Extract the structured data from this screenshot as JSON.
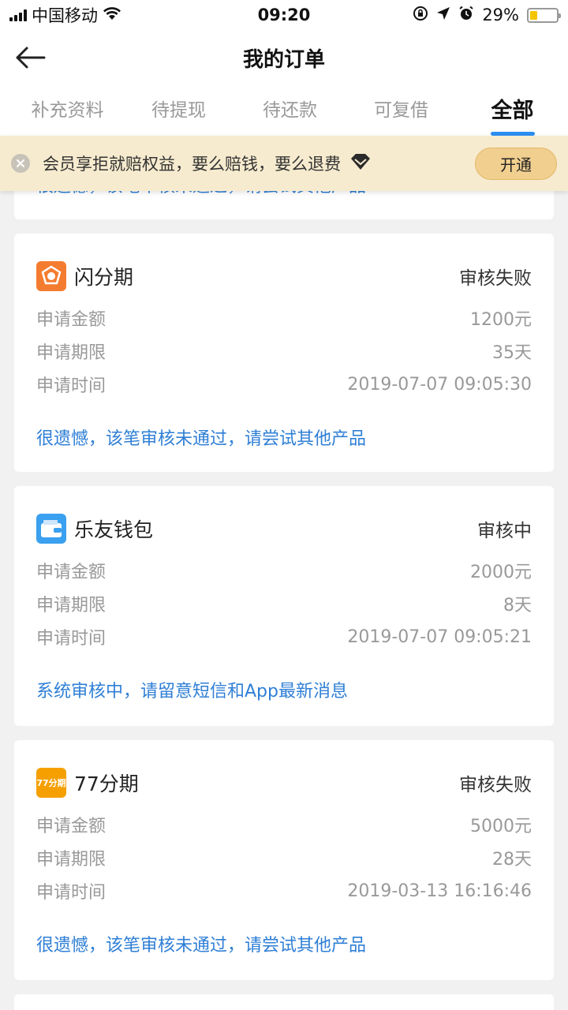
{
  "status_bar": {
    "carrier": "中国移动",
    "time": "09:20",
    "battery": "29%",
    "battery_level": 0.29,
    "icons": [
      "signal-icon",
      "wifi-icon",
      "lock-rotation-icon",
      "location-icon",
      "alarm-icon",
      "battery-icon"
    ]
  },
  "header": {
    "title": "我的订单",
    "back_icon": "arrow-left-icon"
  },
  "tabs": [
    {
      "label": "补充资料",
      "active": false
    },
    {
      "label": "待提现",
      "active": false
    },
    {
      "label": "待还款",
      "active": false
    },
    {
      "label": "可复借",
      "active": false
    },
    {
      "label": "全部",
      "active": true
    }
  ],
  "banner": {
    "text": "会员享拒就赔权益，要么赔钱，要么退费",
    "button": "开通",
    "close_icon": "close-icon",
    "badge_icon": "diamond-icon"
  },
  "partial_card": {
    "message": "很遗憾，该笔审核未通过，请尝试其他产品"
  },
  "orders": [
    {
      "name": "闪分期",
      "status": "审核失败",
      "amount_label": "申请金额",
      "amount": "1200元",
      "term_label": "申请期限",
      "term": "35天",
      "time_label": "申请时间",
      "time": "2019-07-07 09:05:30",
      "message": "很遗憾，该笔审核未通过，请尝试其他产品",
      "logo_color": "#f47c30"
    },
    {
      "name": "乐友钱包",
      "status": "审核中",
      "amount_label": "申请金额",
      "amount": "2000元",
      "term_label": "申请期限",
      "term": "8天",
      "time_label": "申请时间",
      "time": "2019-07-07 09:05:21",
      "message": "系统审核中，请留意短信和App最新消息",
      "logo_color": "#3aa0f0"
    },
    {
      "name": "77分期",
      "status": "审核失败",
      "amount_label": "申请金额",
      "amount": "5000元",
      "term_label": "申请期限",
      "term": "28天",
      "time_label": "申请时间",
      "time": "2019-03-13 16:16:46",
      "message": "很遗憾，该笔审核未通过，请尝试其他产品",
      "logo_color": "#f5a000",
      "logo_text": "77分期"
    }
  ]
}
